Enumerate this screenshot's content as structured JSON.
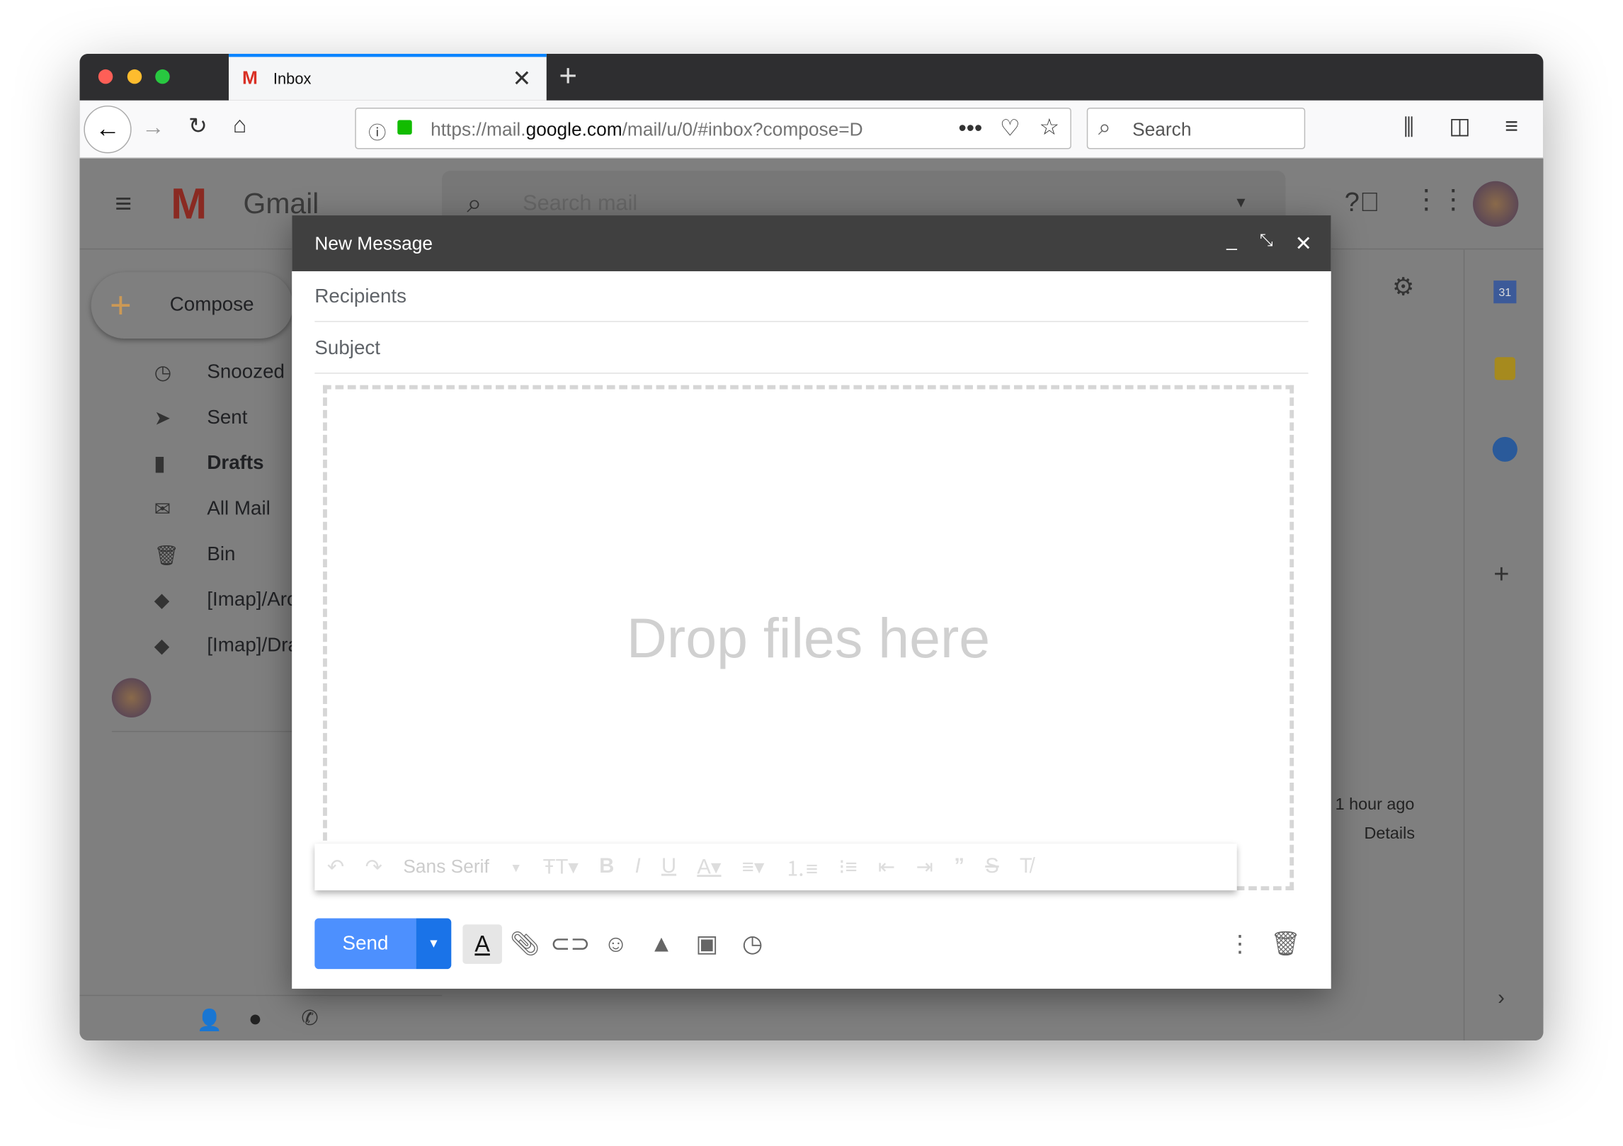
{
  "browser": {
    "tab_title": "Inbox",
    "url_prefix": "https://mail.",
    "url_domain": "google.com",
    "url_rest": "/mail/u/0/#inbox?compose=D",
    "search_placeholder": "Search"
  },
  "gmail": {
    "logo_text": "Gmail",
    "search_placeholder": "Search mail",
    "compose_label": "Compose",
    "nav": [
      {
        "label": "Snoozed",
        "icon": "clock-icon"
      },
      {
        "label": "Sent",
        "icon": "send-icon"
      },
      {
        "label": "Drafts",
        "icon": "draft-icon"
      },
      {
        "label": "All Mail",
        "icon": "mail-icon"
      },
      {
        "label": "Bin",
        "icon": "trash-icon"
      },
      {
        "label": "[Imap]/Archive",
        "icon": "label-icon"
      },
      {
        "label": "[Imap]/Drafts",
        "icon": "label-icon"
      }
    ],
    "activity_time": "1 hour ago",
    "details_link": "Details"
  },
  "compose": {
    "title": "New Message",
    "recipients_placeholder": "Recipients",
    "subject_placeholder": "Subject",
    "drop_text": "Drop files here",
    "font_name": "Sans Serif",
    "send_label": "Send"
  },
  "colors": {
    "send": "#4d90fe",
    "accent": "#0a84ff",
    "header": "#404040"
  }
}
